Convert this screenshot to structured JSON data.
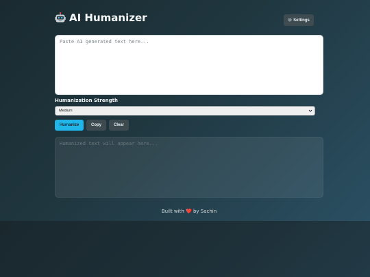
{
  "app": {
    "title": "AI Humanizer",
    "title_icon": "robot-icon",
    "settings_label": "Settings"
  },
  "input": {
    "placeholder": "Paste AI generated text here..."
  },
  "strength": {
    "label": "Humanization Strength",
    "selected": "Medium"
  },
  "actions": {
    "humanize_label": "Humanize",
    "copy_label": "Copy",
    "clear_label": "Clear"
  },
  "output": {
    "placeholder": "Humanized text will appear here..."
  },
  "footer": {
    "prefix": "Built with",
    "heart": "❤️",
    "suffix": "by Sachin"
  },
  "colors": {
    "accent": "#21b6ea",
    "button_dark": "#3d4a50",
    "heart": "#e5484d"
  }
}
